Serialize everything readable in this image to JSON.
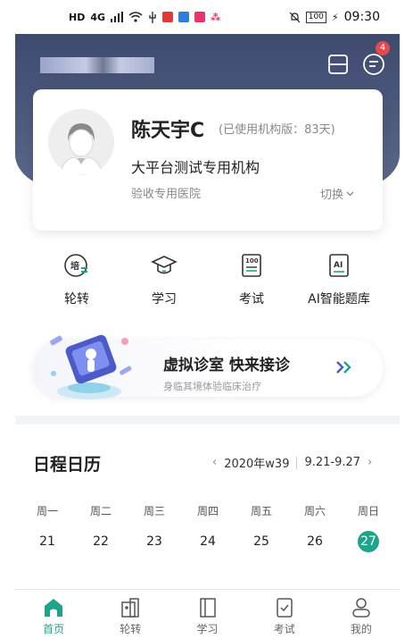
{
  "status_bar": {
    "network_label": "HD",
    "signal_label": "4G",
    "battery": "100",
    "time": "09:30",
    "colors": {
      "red": "#e03b3b",
      "blue": "#2f7de1",
      "pink": "#e8356b"
    }
  },
  "header": {
    "message_badge": "4",
    "colors": {
      "band_top": "#3e4a6e",
      "band_bottom": "#5c6889"
    }
  },
  "profile": {
    "name": "陈天宇C",
    "subscription": "(已使用机构版：83天)",
    "organization": "大平台测试专用机构",
    "hospital": "验收专用医院",
    "switch_label": "切换"
  },
  "quick_menu": [
    {
      "label": "轮转",
      "icon": "rotation-icon"
    },
    {
      "label": "学习",
      "icon": "graduation-cap-icon"
    },
    {
      "label": "考试",
      "icon": "exam-paper-icon"
    },
    {
      "label": "AI智能题库",
      "icon": "ai-question-bank-icon"
    }
  ],
  "banner": {
    "title": "虚拟诊室 快来接诊",
    "subtitle": "身临其境体验临床治疗"
  },
  "calendar": {
    "title": "日程日历",
    "week_label": "2020年w39",
    "range_label": "9.21-9.27",
    "weekdays": [
      "周一",
      "周二",
      "周三",
      "周四",
      "周五",
      "周六",
      "周日"
    ],
    "days": [
      "21",
      "22",
      "23",
      "24",
      "25",
      "26",
      "27"
    ],
    "today": "27",
    "accent": "#1fa38a"
  },
  "bottom_nav": [
    {
      "label": "首页",
      "icon": "home-icon",
      "active": true
    },
    {
      "label": "轮转",
      "icon": "rotation-tab-icon",
      "active": false
    },
    {
      "label": "学习",
      "icon": "book-icon",
      "active": false
    },
    {
      "label": "考试",
      "icon": "exam-tab-icon",
      "active": false
    },
    {
      "label": "我的",
      "icon": "profile-icon",
      "active": false
    }
  ]
}
